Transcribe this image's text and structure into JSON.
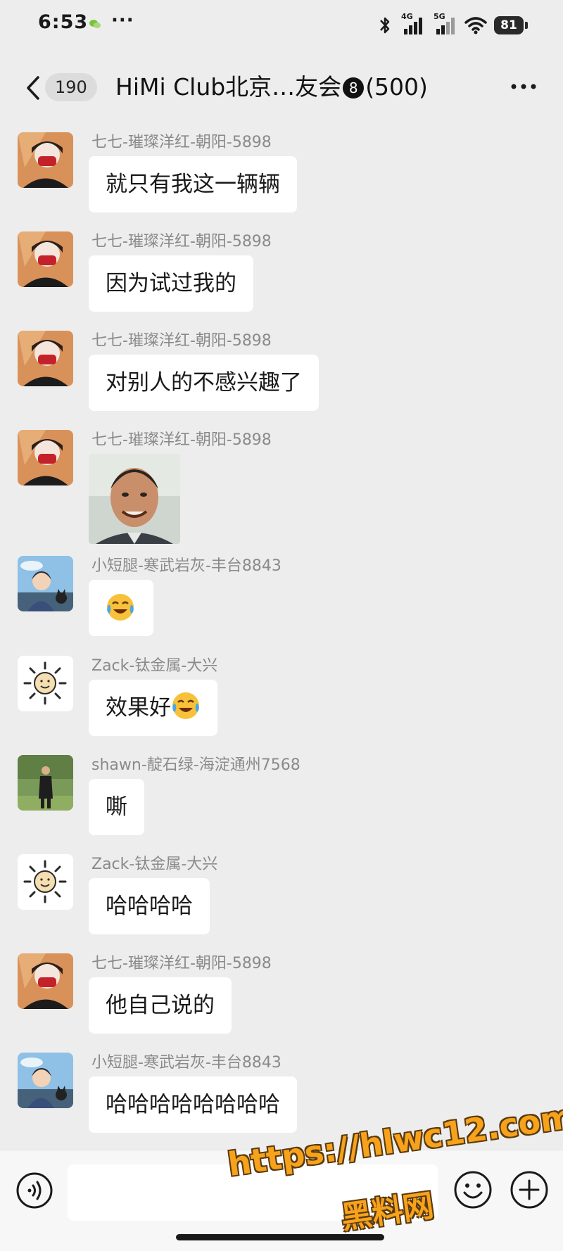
{
  "status_bar": {
    "time": "6:53",
    "dots": "···",
    "network_1": "4G",
    "network_2": "5G",
    "battery": "81"
  },
  "header": {
    "unread_count": "190",
    "title_prefix": "HiMi Club北京…友会",
    "title_badge": "8",
    "title_suffix": "(500)"
  },
  "messages": [
    {
      "sender": "七七-璀璨洋红-朝阳-5898",
      "text": "就只有我这一辆辆",
      "avatar": "girl-red-mask"
    },
    {
      "sender": "七七-璀璨洋红-朝阳-5898",
      "text": "因为试过我的",
      "avatar": "girl-red-mask"
    },
    {
      "sender": "七七-璀璨洋红-朝阳-5898",
      "text": "对别人的不感兴趣了",
      "avatar": "girl-red-mask"
    },
    {
      "sender": "七七-璀璨洋红-朝阳-5898",
      "text": "",
      "sticker": "smiling-man-photo",
      "avatar": "girl-red-mask"
    },
    {
      "sender": "小短腿-寒武岩灰-丰台8843",
      "text": "",
      "emoji": "laughing-crying-emoji",
      "avatar": "anime-boy-cat"
    },
    {
      "sender": "Zack-钛金属-大兴",
      "text": "效果好",
      "emoji": "laugh-tears-emoji",
      "avatar": "sun-doodle"
    },
    {
      "sender": "shawn-靛石绿-海淀通州7568",
      "text": "嘶",
      "avatar": "man-in-field"
    },
    {
      "sender": "Zack-钛金属-大兴",
      "text": "哈哈哈哈",
      "avatar": "sun-doodle"
    },
    {
      "sender": "七七-璀璨洋红-朝阳-5898",
      "text": "他自己说的",
      "avatar": "girl-red-mask"
    },
    {
      "sender": "小短腿-寒武岩灰-丰台8843",
      "text": "哈哈哈哈哈哈哈哈",
      "avatar": "anime-boy-cat"
    }
  ],
  "input_bar": {
    "placeholder": ""
  },
  "watermark": {
    "url": "https://hlwc12.com",
    "name": "黑料网"
  },
  "colors": {
    "background": "#ededed",
    "bubble": "#ffffff",
    "sender_text": "#8a8a8a",
    "watermark": "#f7a21b"
  }
}
